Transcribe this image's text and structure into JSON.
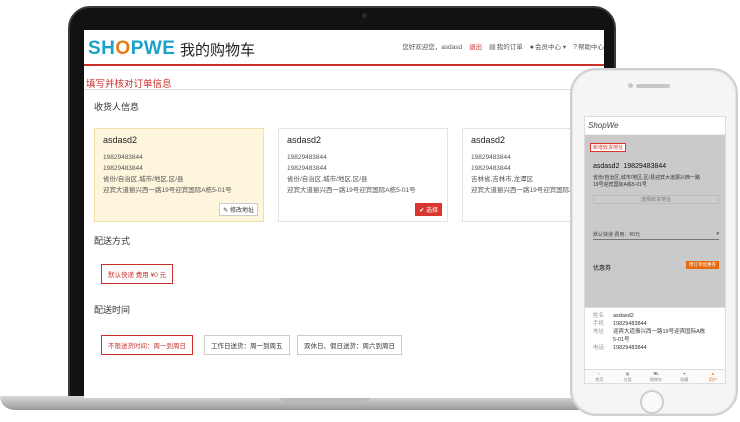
{
  "header": {
    "logo_pre": "SH",
    "logo_o": "O",
    "logo_post": "PWE",
    "title": "我的购物车",
    "welcome": "您好欢迎您，asdasd",
    "logout": "退出",
    "orders": "我的订单",
    "member": "会员中心",
    "help": "帮助中心"
  },
  "page": {
    "section_title": "填写并核对订单信息",
    "receiver_title": "收货人信息",
    "shipping_title": "配送方式",
    "time_title": "配送时间"
  },
  "addresses": [
    {
      "name": "asdasd2",
      "phone1": "19829483844",
      "phone2": "19829483844",
      "region": "省份/自治区,城市/地区,区/县",
      "street": "迎宾大道振兴西一路19号迎宾国际A栋5-01号",
      "button": "修改地址"
    },
    {
      "name": "asdasd2",
      "phone1": "19829483844",
      "phone2": "19829483844",
      "region": "省份/自治区,城市/地区,区/县",
      "street": "迎宾大道振兴西一路19号迎宾国际A栋5-01号",
      "button": "选择"
    },
    {
      "name": "asdasd2",
      "phone1": "19829483844",
      "phone2": "19829483844",
      "region": "吉林省,吉林市,龙潭区",
      "street": "迎宾大道振兴西一路19号迎宾国际A栋5-01号"
    }
  ],
  "shipping": {
    "default": "默认快递 费用 ¥0 元"
  },
  "delivery_times": [
    "不限送货时间：周一到周日",
    "工作日送货：周一到周五",
    "双休日、假日送货：周六到周日"
  ],
  "phone": {
    "logo": "ShopWe",
    "badge": "新增收货地址",
    "name": "asdasd2",
    "tel": "19829483844",
    "addr1": "省份/自治区,城市/地区,区/县迎宾大道振兴西一路",
    "addr2": "19号迎宾国际A栋5-01号",
    "pick": "选择收货地址",
    "ship": "默认快递 费用：¥0元",
    "coupon": "优惠券",
    "coupon_btn": "用订单优惠券",
    "panel": [
      {
        "k": "姓名",
        "v": "asdasd2"
      },
      {
        "k": "手机",
        "v": "19829483844"
      },
      {
        "k": "地址",
        "v": "迎宾大道振兴西一路19号迎宾国际A栋"
      },
      {
        "k": "",
        "v": "5-01号"
      },
      {
        "k": "电话",
        "v": "19829483844"
      }
    ],
    "nav": [
      "首页",
      "分类",
      "购物车",
      "收藏",
      "用户"
    ]
  }
}
